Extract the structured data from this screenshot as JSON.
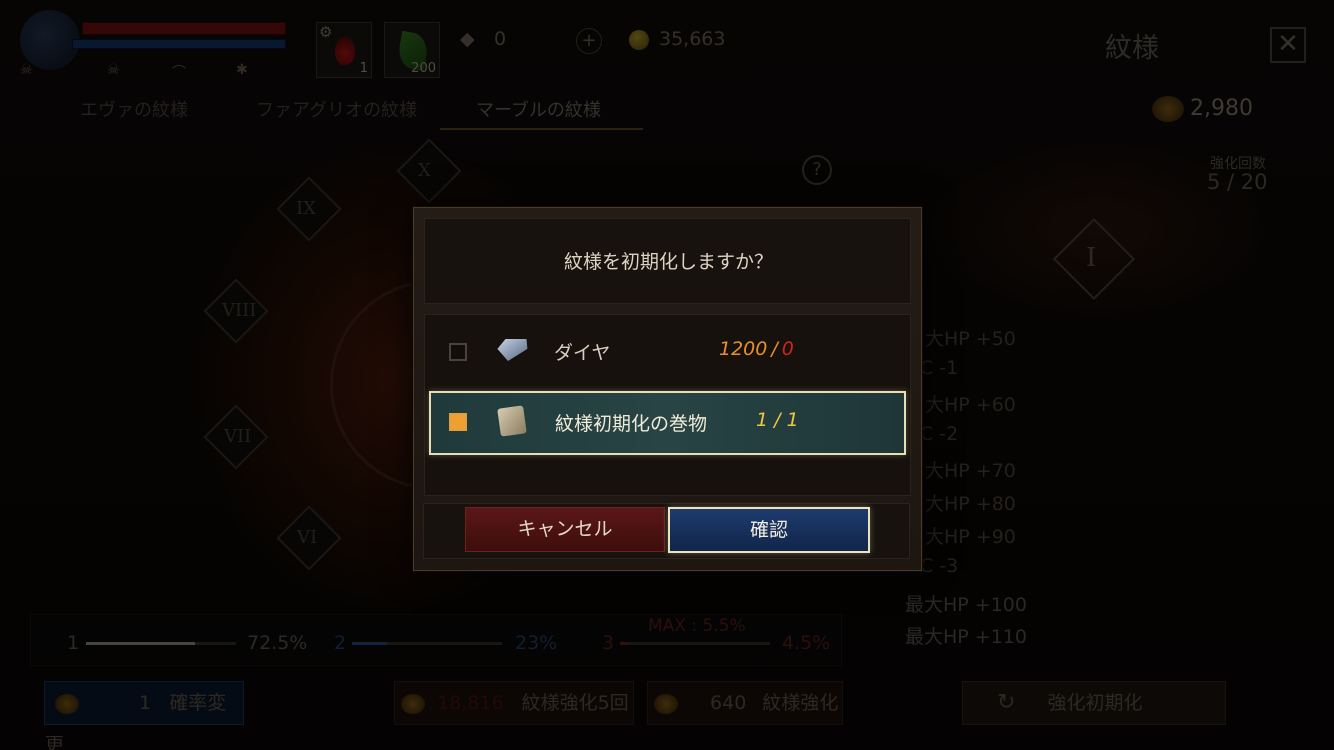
{
  "hud": {
    "potion_count": "1",
    "leaf_count": "200",
    "diamond_count": "0",
    "gold": "35,663"
  },
  "screen": {
    "title": "紋様",
    "close": "✕",
    "tabs": [
      {
        "label": "エヴァの紋様"
      },
      {
        "label": "ファアグリオの紋様"
      },
      {
        "label": "マーブルの紋様"
      }
    ],
    "points": "2,980",
    "enhance_label": "強化回数",
    "enhance_value": "5 / 20",
    "help": "?",
    "emblem_num": "I",
    "nodes": [
      "IX",
      "VIII",
      "VII",
      "VI",
      "X"
    ]
  },
  "stats": [
    "大HP  +50",
    "C -1",
    "大HP  +60",
    "C -2",
    "大HP  +70",
    "大HP  +80",
    "大HP  +90",
    "C -3",
    "最大HP  +100",
    "最大HP  +110"
  ],
  "rates": {
    "r1_n": "1",
    "r1_pct": "72.5%",
    "r2_n": "2",
    "r2_pct": "23%",
    "r3_n": "3",
    "r3_pct": "4.5%",
    "max_label": "MAX : 5.5%"
  },
  "bottom": {
    "rate_change_cost": "1",
    "rate_change_label": "確率変更",
    "enhance5_cost": "18,816",
    "enhance5_label": "紋様強化5回",
    "enhance_cost": "640",
    "enhance_label": "紋様強化",
    "reset_label": "強化初期化"
  },
  "dialog": {
    "message": "紋様を初期化しますか？",
    "option1": {
      "label": "ダイヤ",
      "need": "1200",
      "sep": "/",
      "have": "0",
      "checked": false
    },
    "option2": {
      "label": "紋様初期化の巻物",
      "qty": "1 / 1",
      "checked": true
    },
    "cancel": "キャンセル",
    "confirm": "確認"
  }
}
